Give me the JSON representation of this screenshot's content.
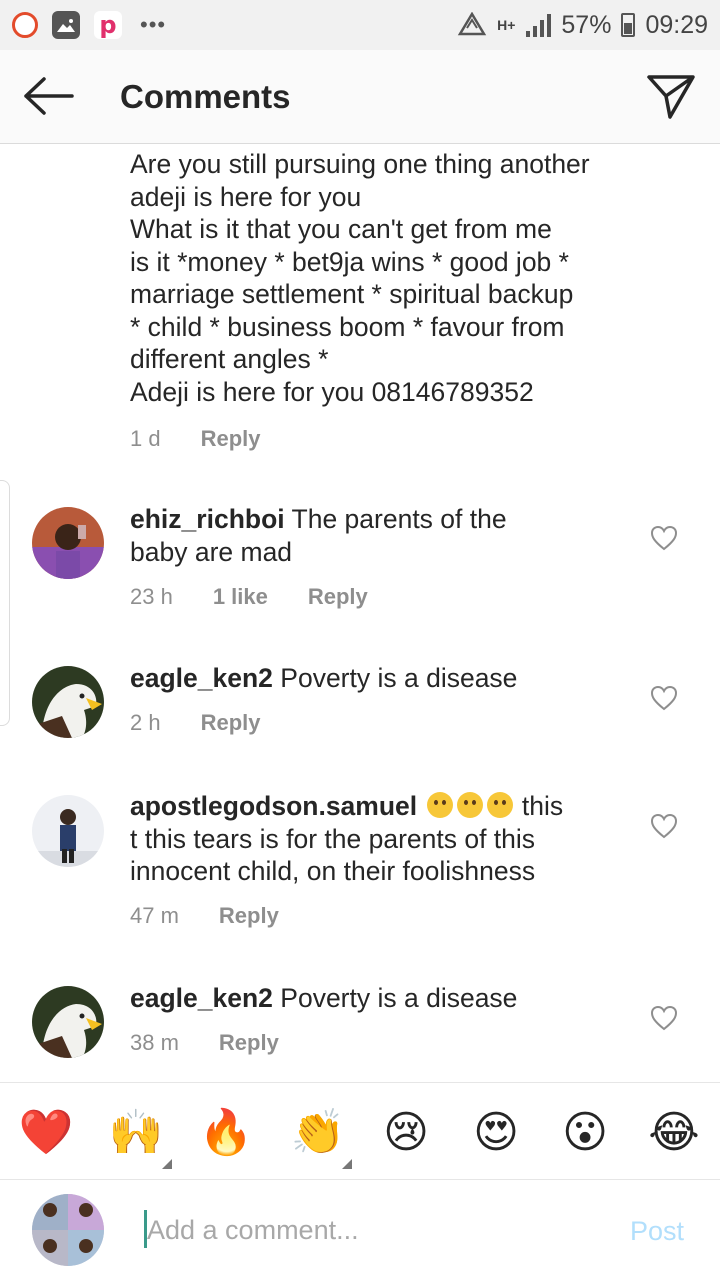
{
  "status_bar": {
    "icons": [
      "opera-icon",
      "gallery-icon",
      "picsart-icon"
    ],
    "more": "•••",
    "network": "H+",
    "battery": "57%",
    "time": "09:29"
  },
  "header": {
    "title": "Comments",
    "back_icon": "arrow-left-icon",
    "send_icon": "paper-plane-icon"
  },
  "comments": [
    {
      "username": "",
      "lines": [
        "Are you still pursuing one thing another",
        "adeji is here for you",
        "What is it that you can't get from me",
        "is it *money * bet9ja wins * good job *",
        "marriage settlement * spiritual backup",
        "* child * business boom * favour from",
        "different angles *",
        "Adeji is here for you 08146789352"
      ],
      "time": "1 d",
      "likes": "",
      "reply": "Reply"
    },
    {
      "username": "ehiz_richboi",
      "text_first": "The parents of the",
      "text_rest": "baby are mad",
      "time": "23 h",
      "likes": "1 like",
      "reply": "Reply"
    },
    {
      "username": "eagle_ken2",
      "text_first": "Poverty is a disease",
      "time": "2 h",
      "reply": "Reply"
    },
    {
      "username": "apostlegodson.samuel",
      "text_first": "this",
      "line2": "t this tears is for the parents of this",
      "line3": "innocent child, on their foolishness",
      "time": "47 m",
      "reply": "Reply"
    },
    {
      "username": "eagle_ken2",
      "text_first": "Poverty is a disease",
      "time": "38 m",
      "reply": "Reply"
    }
  ],
  "emoji_bar": [
    "❤️",
    "🙌",
    "🔥",
    "👏",
    "😢",
    "😍",
    "😮",
    "😂"
  ],
  "input": {
    "placeholder": "Add a comment...",
    "post_label": "Post"
  },
  "colors": {
    "text": "#262626",
    "meta": "#8e8e8e",
    "post_disabled": "#b2dffc",
    "header_bg": "#fafafa"
  }
}
